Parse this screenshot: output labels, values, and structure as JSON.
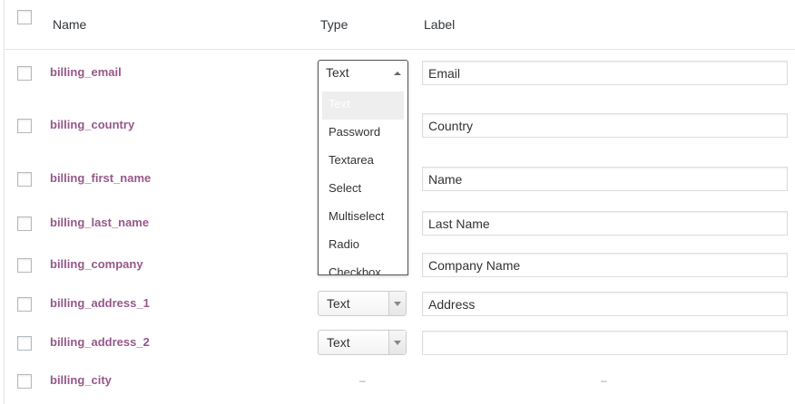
{
  "table": {
    "headers": {
      "name": "Name",
      "type": "Type",
      "label": "Label"
    },
    "rows": [
      {
        "name": "billing_email",
        "type": "Text",
        "label": "Email"
      },
      {
        "name": "billing_country",
        "type": "",
        "label": "Country"
      },
      {
        "name": "billing_first_name",
        "type": "",
        "label": "Name"
      },
      {
        "name": "billing_last_name",
        "type": "",
        "label": "Last Name"
      },
      {
        "name": "billing_company",
        "type": "",
        "label": "Company Name"
      },
      {
        "name": "billing_address_1",
        "type": "Text",
        "label": "Address"
      },
      {
        "name": "billing_address_2",
        "type": "Text",
        "label": ""
      },
      {
        "name": "billing_city",
        "type": "–",
        "label": "–"
      }
    ]
  },
  "type_dropdown": {
    "selected": "Text",
    "options": [
      "Text",
      "Password",
      "Textarea",
      "Select",
      "Multiselect",
      "Radio",
      "Checkbox"
    ],
    "highlighted": "Text"
  },
  "colors": {
    "field_name": "#96588a",
    "header_text": "#32373c",
    "border": "#dddddd"
  }
}
